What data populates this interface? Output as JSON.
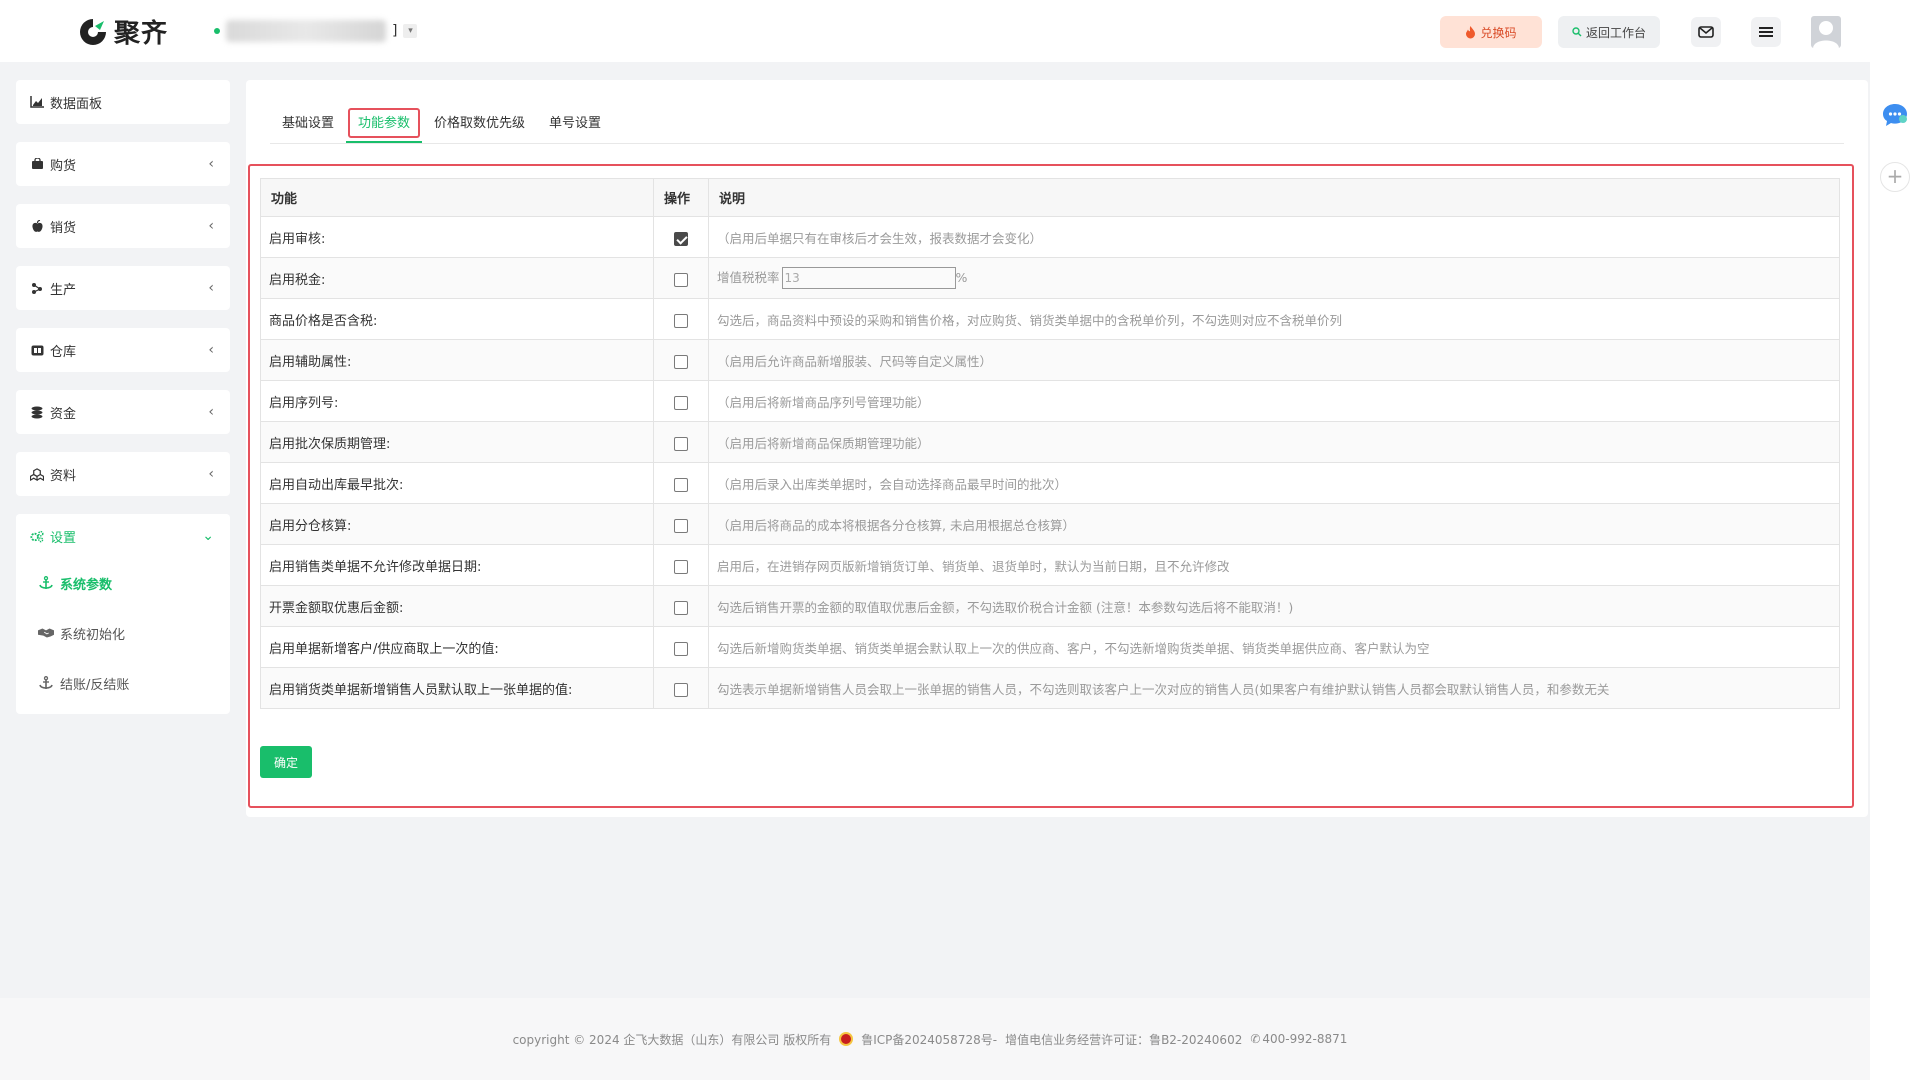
{
  "brand": {
    "name": "聚齐",
    "accent": "#19be6b",
    "highlight": "#e6515c"
  },
  "header": {
    "company_suffix": "]",
    "redeem_label": "兑换码",
    "back_label": "返回工作台"
  },
  "sidebar": {
    "items": [
      {
        "label": "数据面板",
        "icon": "chart-icon"
      },
      {
        "label": "购货",
        "icon": "cart-icon"
      },
      {
        "label": "销货",
        "icon": "apple-icon"
      },
      {
        "label": "生产",
        "icon": "factory-icon"
      },
      {
        "label": "仓库",
        "icon": "warehouse-icon"
      },
      {
        "label": "资金",
        "icon": "coins-icon"
      },
      {
        "label": "资料",
        "icon": "cubes-icon"
      }
    ],
    "settings": {
      "label": "设置",
      "sub": [
        {
          "label": "系统参数",
          "icon": "anchor-icon"
        },
        {
          "label": "系统初始化",
          "icon": "handshake-icon"
        },
        {
          "label": "结账/反结账",
          "icon": "anchor-icon"
        }
      ]
    }
  },
  "tabs": [
    {
      "label": "基础设置"
    },
    {
      "label": "功能参数"
    },
    {
      "label": "价格取数优先级"
    },
    {
      "label": "单号设置"
    }
  ],
  "table": {
    "headers": {
      "function": "功能",
      "operation": "操作",
      "description": "说明"
    },
    "rows": [
      {
        "name": "启用审核:",
        "checked": true,
        "desc": "（启用后单据只有在审核后才会生效，报表数据才会变化）"
      },
      {
        "name": "启用税金:",
        "checked": false,
        "tax_label": "增值税税率",
        "tax_value": "13",
        "tax_unit": "%"
      },
      {
        "name": "商品价格是否含税:",
        "checked": false,
        "desc": "勾选后，商品资料中预设的采购和销售价格，对应购货、销货类单据中的含税单价列，不勾选则对应不含税单价列"
      },
      {
        "name": "启用辅助属性:",
        "checked": false,
        "desc": "（启用后允许商品新增服装、尺码等自定义属性）"
      },
      {
        "name": "启用序列号:",
        "checked": false,
        "desc": "（启用后将新增商品序列号管理功能）"
      },
      {
        "name": "启用批次保质期管理:",
        "checked": false,
        "desc": "（启用后将新增商品保质期管理功能）"
      },
      {
        "name": "启用自动出库最早批次:",
        "checked": false,
        "desc": "（启用后录入出库类单据时，会自动选择商品最早时间的批次）"
      },
      {
        "name": "启用分仓核算:",
        "checked": false,
        "desc": "（启用后将商品的成本将根据各分仓核算, 未启用根据总仓核算）"
      },
      {
        "name": "启用销售类单据不允许修改单据日期:",
        "checked": false,
        "desc": "启用后，在进销存网页版新增销货订单、销货单、退货单时，默认为当前日期，且不允许修改"
      },
      {
        "name": "开票金额取优惠后金额:",
        "checked": false,
        "desc": "勾选后销售开票的金额的取值取优惠后金额，不勾选取价税合计金额 (注意！本参数勾选后将不能取消！)"
      },
      {
        "name": "启用单据新增客户/供应商取上一次的值:",
        "checked": false,
        "desc": "勾选后新增购货类单据、销货类单据会默认取上一次的供应商、客户，不勾选新增购货类单据、销货类单据供应商、客户默认为空"
      },
      {
        "name": "启用销货类单据新增销售人员默认取上一张单据的值:",
        "checked": false,
        "desc": "勾选表示单据新增销售人员会取上一张单据的销售人员，不勾选则取该客户上一次对应的销售人员(如果客户有维护默认销售人员都会取默认销售人员，和参数无关"
      }
    ]
  },
  "confirm_label": "确定",
  "footer": {
    "copyright": "copyright © 2024 企飞大数据（山东）有限公司 版权所有",
    "icp": "鲁ICP备2024058728号-",
    "license": "增值电信业务经营许可证：鲁B2-20240602",
    "phone": "400-992-8871"
  }
}
